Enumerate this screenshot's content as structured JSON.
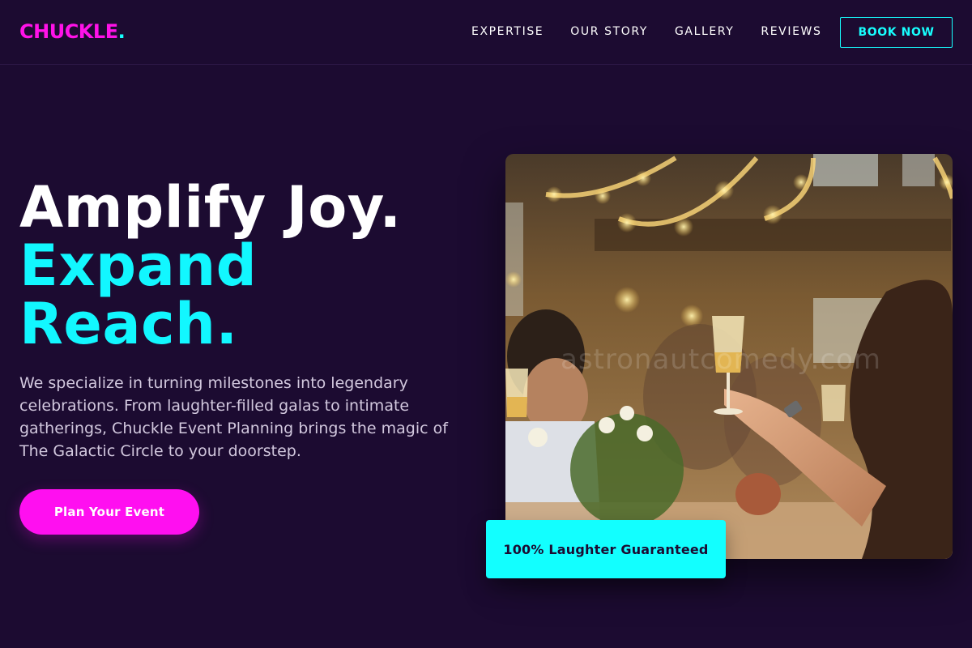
{
  "header": {
    "logo_text": "CHUCKLE",
    "logo_dot": ".",
    "nav": [
      {
        "label": "EXPERTISE"
      },
      {
        "label": "OUR STORY"
      },
      {
        "label": "GALLERY"
      },
      {
        "label": "REVIEWS"
      }
    ],
    "book_button": "BOOK NOW"
  },
  "hero": {
    "headline_line1": "Amplify Joy.",
    "headline_line2": "Expand",
    "headline_line3": "Reach.",
    "description": "We specialize in turning milestones into legendary celebrations. From laughter-filled galas to intimate gatherings, Chuckle Event Planning brings the magic of The Galactic Circle to your doorstep.",
    "cta_label": "Plan Your Event",
    "image": {
      "icon": "celebration-photo-toast",
      "watermark": "astronautcomedy.com"
    },
    "badge_text": "100% Laughter Guaranteed"
  },
  "colors": {
    "background": "#1c0b31",
    "accent_magenta": "#ff12e8",
    "accent_cyan": "#17ffff",
    "text_muted": "#d2c8de"
  }
}
